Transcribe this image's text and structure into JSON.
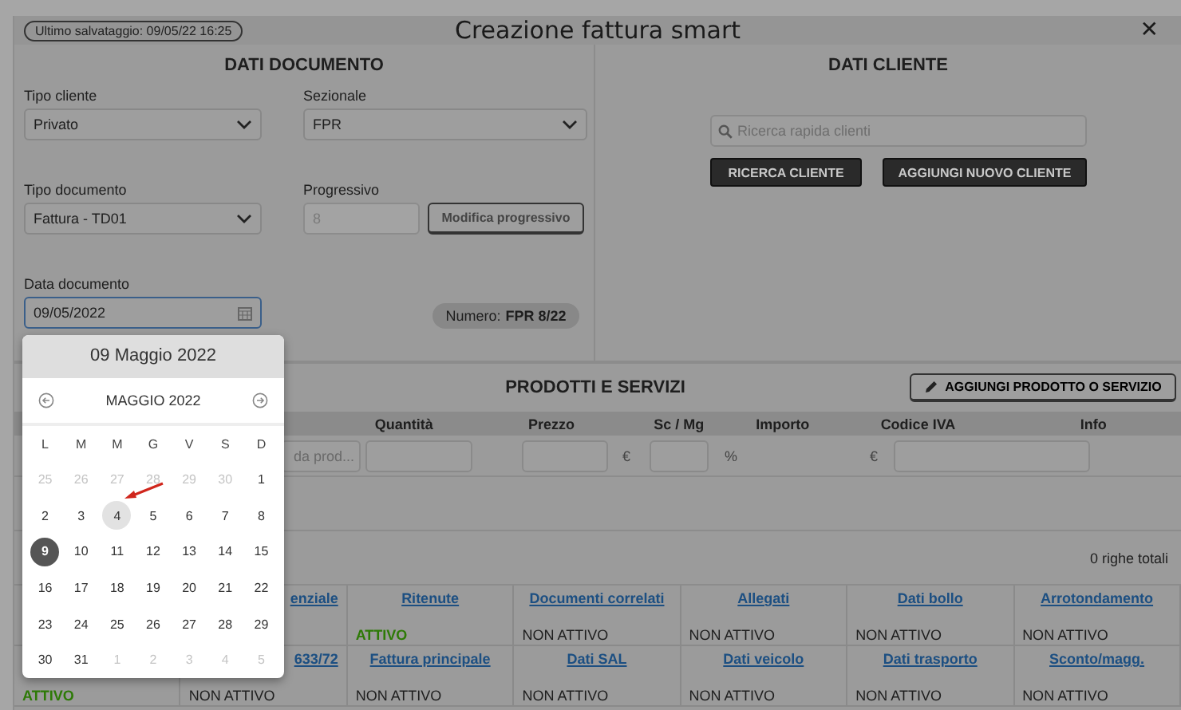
{
  "last_save": "Ultimo salvataggio: 09/05/22 16:25",
  "title": "Creazione fattura smart",
  "close": "✕",
  "document": {
    "heading": "DATI DOCUMENTO",
    "tipo_cliente": {
      "label": "Tipo cliente",
      "value": "Privato"
    },
    "sezionale": {
      "label": "Sezionale",
      "value": "FPR"
    },
    "tipo_documento": {
      "label": "Tipo documento",
      "value": "Fattura - TD01"
    },
    "progressivo": {
      "label": "Progressivo",
      "value": "8",
      "disabled": true,
      "button": "Modifica progressivo"
    },
    "data_documento": {
      "label": "Data documento",
      "value": "09/05/2022",
      "focused": true
    },
    "numero": {
      "label": "Numero:",
      "value": "FPR 8/22"
    }
  },
  "client": {
    "heading": "DATI CLIENTE",
    "search": {
      "placeholder": "Ricerca rapida clienti"
    },
    "buttons": [
      "RICERCA CLIENTE",
      "AGGIUNGI NUOVO CLIENTE"
    ]
  },
  "products": {
    "heading": "PRODOTTI E SERVIZI",
    "add_button": "AGGIUNGI PRODOTTO O SERVIZIO",
    "columns": [
      "Quantità",
      "Prezzo",
      "Sc / Mg",
      "Importo",
      "Codice IVA",
      "Info"
    ],
    "product_placeholder": "da prod...",
    "units": [
      "€",
      "%",
      "€"
    ],
    "total_rows": "0 righe totali"
  },
  "options": [
    [
      {
        "label": "enziale"
      },
      {
        "label": "Ritenute",
        "status": "ATTIVO",
        "active": true
      },
      {
        "label": "Documenti correlati",
        "status": "NON ATTIVO",
        "active": false
      },
      {
        "label": "Allegati",
        "status": "NON ATTIVO",
        "active": false
      },
      {
        "label": "Dati bollo",
        "status": "NON ATTIVO",
        "active": false
      },
      {
        "label": "Arrotondamento",
        "status": "NON ATTIVO",
        "active": false
      }
    ],
    [
      {
        "status": "ATTIVO",
        "active": true
      },
      {
        "label": "633/72",
        "status": "NON ATTIVO",
        "active": false
      },
      {
        "label": "Fattura principale",
        "status": "NON ATTIVO",
        "active": false
      },
      {
        "label": "Dati SAL",
        "status": "NON ATTIVO",
        "active": false
      },
      {
        "label": "Dati veicolo",
        "status": "NON ATTIVO",
        "active": false
      },
      {
        "label": "Dati trasporto",
        "status": "NON ATTIVO",
        "active": false
      },
      {
        "label": "Sconto/magg.",
        "status": "NON ATTIVO",
        "active": false
      }
    ]
  ],
  "calendar": {
    "header": "09 Maggio 2022",
    "month": "MAGGIO 2022",
    "weekdays": [
      "L",
      "M",
      "M",
      "G",
      "V",
      "S",
      "D"
    ],
    "weeks": [
      [
        {
          "day": "25",
          "muted": true,
          "selected": false,
          "today": false
        },
        {
          "day": "26",
          "muted": true,
          "selected": false,
          "today": false
        },
        {
          "day": "27",
          "muted": true,
          "selected": false,
          "today": false
        },
        {
          "day": "28",
          "muted": true,
          "selected": false,
          "today": false
        },
        {
          "day": "29",
          "muted": true,
          "selected": false,
          "today": false
        },
        {
          "day": "30",
          "muted": true,
          "selected": false,
          "today": false
        },
        {
          "day": "1",
          "muted": false,
          "selected": false,
          "today": false
        }
      ],
      [
        {
          "day": "2",
          "muted": false,
          "selected": false,
          "today": false
        },
        {
          "day": "3",
          "muted": false,
          "selected": false,
          "today": false
        },
        {
          "day": "4",
          "muted": false,
          "selected": false,
          "today": true
        },
        {
          "day": "5",
          "muted": false,
          "selected": false,
          "today": false
        },
        {
          "day": "6",
          "muted": false,
          "selected": false,
          "today": false
        },
        {
          "day": "7",
          "muted": false,
          "selected": false,
          "today": false
        },
        {
          "day": "8",
          "muted": false,
          "selected": false,
          "today": false
        }
      ],
      [
        {
          "day": "9",
          "muted": false,
          "selected": true,
          "today": false
        },
        {
          "day": "10",
          "muted": false,
          "selected": false,
          "today": false
        },
        {
          "day": "11",
          "muted": false,
          "selected": false,
          "today": false
        },
        {
          "day": "12",
          "muted": false,
          "selected": false,
          "today": false
        },
        {
          "day": "13",
          "muted": false,
          "selected": false,
          "today": false
        },
        {
          "day": "14",
          "muted": false,
          "selected": false,
          "today": false
        },
        {
          "day": "15",
          "muted": false,
          "selected": false,
          "today": false
        }
      ],
      [
        {
          "day": "16",
          "muted": false,
          "selected": false,
          "today": false
        },
        {
          "day": "17",
          "muted": false,
          "selected": false,
          "today": false
        },
        {
          "day": "18",
          "muted": false,
          "selected": false,
          "today": false
        },
        {
          "day": "19",
          "muted": false,
          "selected": false,
          "today": false
        },
        {
          "day": "20",
          "muted": false,
          "selected": false,
          "today": false
        },
        {
          "day": "21",
          "muted": false,
          "selected": false,
          "today": false
        },
        {
          "day": "22",
          "muted": false,
          "selected": false,
          "today": false
        }
      ],
      [
        {
          "day": "23",
          "muted": false,
          "selected": false,
          "today": false
        },
        {
          "day": "24",
          "muted": false,
          "selected": false,
          "today": false
        },
        {
          "day": "25",
          "muted": false,
          "selected": false,
          "today": false
        },
        {
          "day": "26",
          "muted": false,
          "selected": false,
          "today": false
        },
        {
          "day": "27",
          "muted": false,
          "selected": false,
          "today": false
        },
        {
          "day": "28",
          "muted": false,
          "selected": false,
          "today": false
        },
        {
          "day": "29",
          "muted": false,
          "selected": false,
          "today": false
        }
      ],
      [
        {
          "day": "30",
          "muted": false,
          "selected": false,
          "today": false
        },
        {
          "day": "31",
          "muted": false,
          "selected": false,
          "today": false
        },
        {
          "day": "1",
          "muted": true,
          "selected": false,
          "today": false
        },
        {
          "day": "2",
          "muted": true,
          "selected": false,
          "today": false
        },
        {
          "day": "3",
          "muted": true,
          "selected": false,
          "today": false
        },
        {
          "day": "4",
          "muted": true,
          "selected": false,
          "today": false
        },
        {
          "day": "5",
          "muted": true,
          "selected": false,
          "today": false
        }
      ]
    ]
  }
}
